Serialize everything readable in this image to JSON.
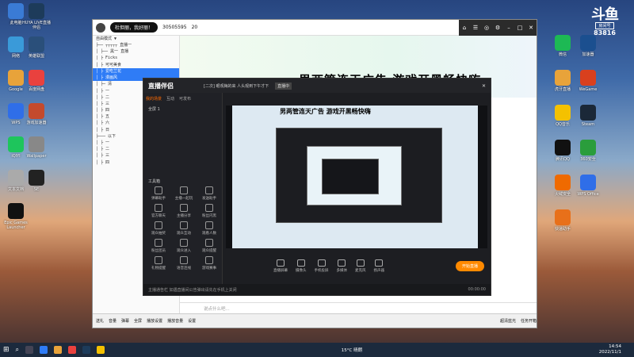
{
  "desktop_icons": [
    {
      "label": "此电脑",
      "color": "#3a7bd5"
    },
    {
      "label": "HUYA LIVE直播伴侣",
      "color": "#1d3b5a"
    },
    {
      "label": "网络",
      "color": "#3a9ad9"
    },
    {
      "label": "英雄联盟",
      "color": "#2a4f7a"
    },
    {
      "label": "Google",
      "color": "#e8a33a"
    },
    {
      "label": "百度网盘",
      "color": "#e9413e"
    },
    {
      "label": "WPS",
      "color": "#2f6ee8"
    },
    {
      "label": "游戏加速器",
      "color": "#c44a2d"
    },
    {
      "label": "iQIYI",
      "color": "#1ec55c"
    },
    {
      "label": "Wallpaper",
      "color": "#888"
    },
    {
      "label": "文本文档",
      "color": "#aaa"
    },
    {
      "label": "SE",
      "color": "#222"
    },
    {
      "label": "Epic Games Launcher",
      "color": "#111"
    }
  ],
  "desktop_right_icons": [
    {
      "label": "微信",
      "color": "#1db954"
    },
    {
      "label": "加速器",
      "color": "#1b4f8f"
    },
    {
      "label": "虎牙直播",
      "color": "#e8a33a"
    },
    {
      "label": "WeGame",
      "color": "#d9401e"
    },
    {
      "label": "QQ音乐",
      "color": "#f4c100"
    },
    {
      "label": "Steam",
      "color": "#1b2838"
    },
    {
      "label": "腾讯QQ",
      "color": "#111"
    },
    {
      "label": "360安全",
      "color": "#2a9d3c"
    },
    {
      "label": "火绒安全",
      "color": "#ef6a00"
    },
    {
      "label": "WPS Office",
      "color": "#2f6ee8"
    },
    {
      "label": "快递助手",
      "color": "#e8701a"
    }
  ],
  "huya": {
    "brand": "斗鱼",
    "sub": "房间号",
    "room": "83816"
  },
  "browser": {
    "pill": "杜但丽，我好丽！",
    "followers": "30505595",
    "likes": "20",
    "banner_title": "男两管连天广告 游戏开黑畅快嗨",
    "chat_placeholder": "说点什么吧...",
    "bottom_items": [
      "送礼",
      "音量",
      "弹幕",
      "全屏",
      "播放设置",
      "播放音量",
      "设置",
      "超清蓝光",
      "任务开箱"
    ]
  },
  "tree": [
    "自由模式 ▼",
    "├──  ┬┬┬┬┬ 直播一 ",
    "│  ├── 黑一  直播",
    "│  ├ Ficks",
    "│  ├ 可可美食",
    "│  ├ 爱吃兰花",
    "│  ├ 漫画风",
    "│  ├─ 清",
    "│  ├ 一",
    "│  ├ 二",
    "│  ├ 三",
    "│  ├ 四",
    "│  ├ 五",
    "│  ├ 六",
    "│  ├ 日",
    "├─── 以下",
    "│  ├ 一",
    "│  ├ 二",
    "│  ├ 三",
    "│  ├ 四"
  ],
  "app": {
    "logo": "直播伴侣",
    "tabs": [
      "我的场景",
      "互动",
      "可发布"
    ],
    "scene": "全屏 1",
    "title_text": "[二次] 眼观梅的来 人头观到下午才下",
    "status": "直播中",
    "tools_header": "工具箱",
    "tools": [
      "弹幕助手",
      "主播一起玩",
      "发送助手",
      "官方聊天",
      "主播分享",
      "粉丝闪黑",
      "观众抽奖",
      "观众互动",
      "观看人数",
      "粉丝团员",
      "观众进入",
      "观众提醒",
      "礼物提醒",
      "语音连线",
      "游戏赛事"
    ],
    "toolbar": [
      "直播屏幕",
      "摄像头",
      "手机投屏",
      "多媒体",
      "麦克风",
      "扬声器"
    ],
    "golive": "开始直播",
    "status_text": "主播通告栏 如遇直播间公告弹出请先在手机上关闭",
    "timer": "00:00:00"
  },
  "taskbar": {
    "temp": "15°C",
    "weather": "晴朗",
    "time": "14:54",
    "date": "2022/11/1"
  }
}
